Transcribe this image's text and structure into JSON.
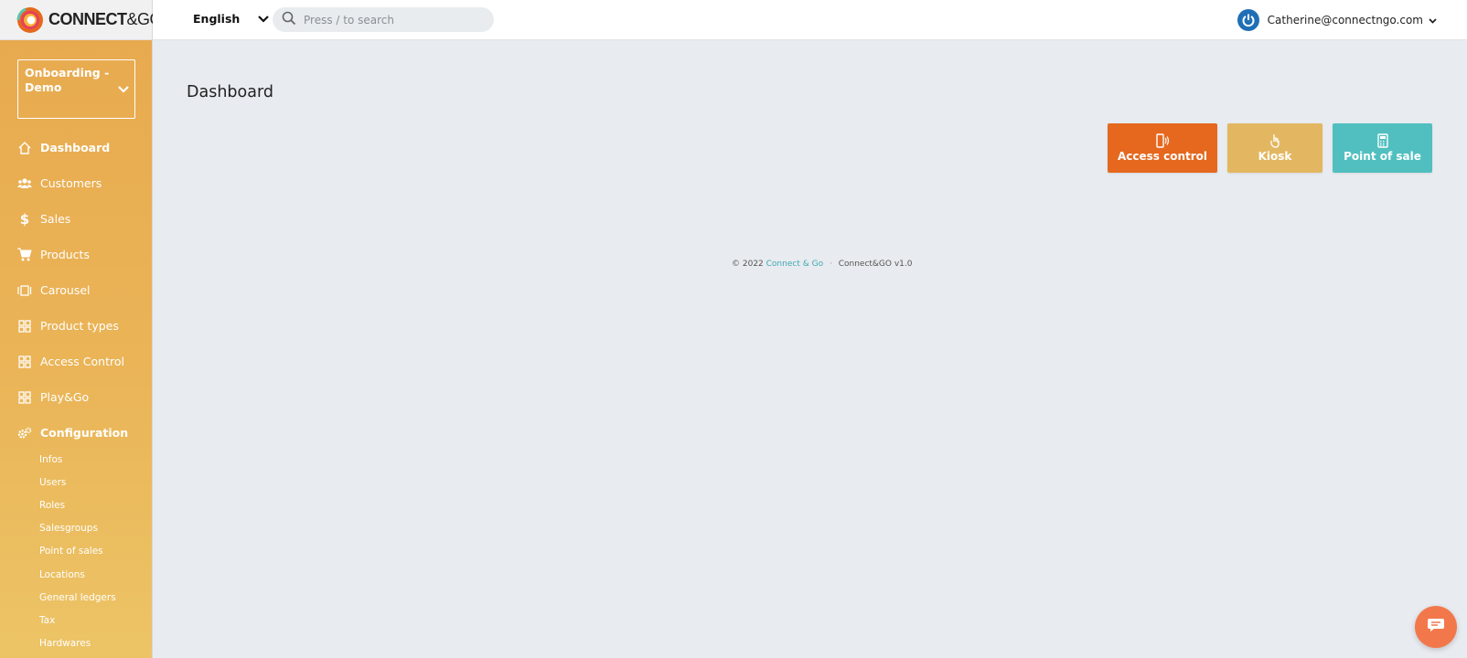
{
  "app": {
    "logo_bold": "CONNECT",
    "logo_thin": "&GO",
    "org_selector": "Onboarding - Demo"
  },
  "header": {
    "language": "English",
    "search_placeholder": "Press / to search",
    "user_email": "Catherine@connectngo.com"
  },
  "sidebar": {
    "items": [
      {
        "label": "Dashboard",
        "icon": "home-icon"
      },
      {
        "label": "Customers",
        "icon": "users-icon"
      },
      {
        "label": "Sales",
        "icon": "dollar-icon"
      },
      {
        "label": "Products",
        "icon": "cart-icon"
      },
      {
        "label": "Carousel",
        "icon": "carousel-icon"
      },
      {
        "label": "Product types",
        "icon": "grid-icon"
      },
      {
        "label": "Access Control",
        "icon": "grid-icon"
      },
      {
        "label": "Play&Go",
        "icon": "grid-icon"
      },
      {
        "label": "Configuration",
        "icon": "gears-icon"
      }
    ],
    "config_items": [
      "Infos",
      "Users",
      "Roles",
      "Salesgroups",
      "Point of sales",
      "Locations",
      "General ledgers",
      "Tax",
      "Hardwares"
    ]
  },
  "main": {
    "title": "Dashboard",
    "tiles": [
      {
        "label": "Access control",
        "icon": "phone-signal-icon",
        "color": "#e5681e"
      },
      {
        "label": "Kiosk",
        "icon": "hand-pointer-icon",
        "color": "#e3b761"
      },
      {
        "label": "Point of sale",
        "icon": "calculator-icon",
        "color": "#51bfbf"
      }
    ]
  },
  "footer": {
    "copyright": "© 2022",
    "company_link": "Connect & Go",
    "separator": "·",
    "version": "Connect&GO v1.0"
  },
  "colors": {
    "sidebar_gradient_top": "#e8a94e",
    "sidebar_gradient_bottom": "#ecc466",
    "background": "#e8ebef",
    "accent_link": "#3fa8b5",
    "chat_button": "#f2784b",
    "avatar": "#1f6fb6"
  }
}
